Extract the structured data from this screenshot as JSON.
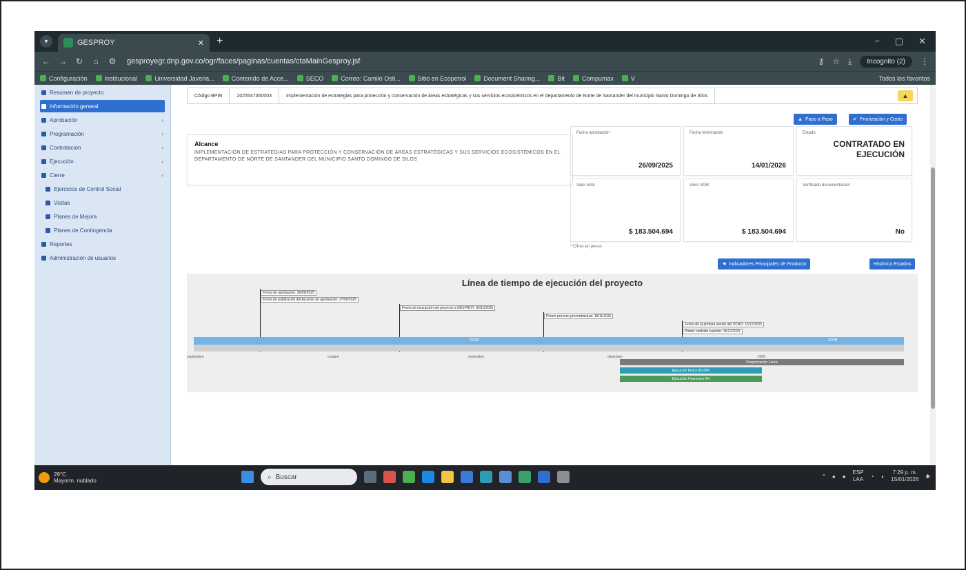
{
  "browser": {
    "tab_title": "GESPROY",
    "new_tab": "+",
    "window_controls": [
      "−",
      "▢",
      "✕"
    ],
    "url": "gesproyegr.dnp.gov.co/ogr/faces/paginas/cuentas/ctaMainGesproy.jsf",
    "incognito_label": "Incognito (2)",
    "bookmarks": [
      "Configuración",
      "Institucional",
      "Universidad Javeria...",
      "Contenido de Acce...",
      "SECO",
      "Correo: Camilo Osti...",
      "Sitio en Ecopetrol",
      "Document Sharing...",
      "Bit",
      "Compumax",
      "V"
    ],
    "bookmarks_right": "Todos los favoritos"
  },
  "sidebar": {
    "items": [
      {
        "label": "Resumen de proyecto",
        "active": false,
        "chevron": false
      },
      {
        "label": "Información general",
        "active": true,
        "chevron": false
      },
      {
        "label": "Aprobación",
        "active": false,
        "chevron": true
      },
      {
        "label": "Programación",
        "active": false,
        "chevron": true
      },
      {
        "label": "Contratación",
        "active": false,
        "chevron": true
      },
      {
        "label": "Ejecución",
        "active": false,
        "chevron": true
      },
      {
        "label": "Cierre",
        "active": false,
        "chevron": true
      },
      {
        "label": "Ejercicios de Control Social",
        "active": false,
        "chevron": false
      },
      {
        "label": "Visitas",
        "active": false,
        "chevron": false
      },
      {
        "label": "Planes de Mejora",
        "active": false,
        "chevron": false
      },
      {
        "label": "Planes de Contingencia",
        "active": false,
        "chevron": false
      },
      {
        "label": "Reportes",
        "active": false,
        "chevron": false
      },
      {
        "label": "Administración de usuarios",
        "active": false,
        "chevron": false
      }
    ]
  },
  "project": {
    "code_label": "Código BPIN",
    "code_value": "2025547450003",
    "title": "Implementación de estrategias para protección y conservación de áreas estratégicas y sus servicios ecosistémicos en el departamento de Norte de Santander del municipio Santo Domingo de Silos",
    "btn_paso": "Paso a Paso",
    "btn_priorizacion": "Priorización y Costo",
    "alcance_heading": "Alcance",
    "alcance_text": "IMPLEMENTACIÓN DE ESTRATEGIAS PARA PROTECCIÓN Y CONSERVACIÓN DE ÁREAS ESTRATÉGICAS Y SUS SERVICIOS ECOSISTÉMICOS EN EL DEPARTAMENTO DE NORTE DE SANTANDER DEL MUNICIPIO SANTO DOMINGO DE SILOS",
    "fecha_aprobacion_label": "Fecha aprobación",
    "fecha_aprobacion": "26/09/2025",
    "fecha_terminacion_label": "Fecha terminación",
    "fecha_terminacion": "14/01/2026",
    "estado_label": "Estado",
    "estado": "CONTRATADO EN EJECUCIÓN",
    "valor_total_label": "Valor total",
    "valor_total": "$ 183.504.694",
    "valor_sgr_label": "Valor SGR",
    "valor_sgr": "$ 183.504.694",
    "verificado_label": "Verificado documentación",
    "verificado": "No",
    "note": "* Cifras en pesos",
    "btn_indicadores": "Indicadores Principales de Producto",
    "btn_historico": "Histórico Estados"
  },
  "timeline": {
    "title": "Línea de tiempo de ejecución del proyecto",
    "events": [
      "Fecha de aprobación: 26/09/2025",
      "Fecha de publicación del Acuerdo de aprobación: 27/09/2025",
      "Fecha de inscripción del proyecto a GESPROY: 06/10/2025",
      "Primer proceso precontractual: 18/11/2025",
      "Fecha de la primera sesión del OCAD: 15/12/2025",
      "Primer contrato suscrito: 15/12/2025"
    ],
    "year_a": "2025",
    "year_b": "2026",
    "months": [
      "septiembre",
      "octubre",
      "noviembre",
      "diciembre",
      "2026"
    ],
    "phases": [
      {
        "label": "Programación Fisica",
        "color": "#7a7a7a"
      },
      {
        "label": "Ejecución Física 95,09%",
        "color": "#2f9bb5"
      },
      {
        "label": "Ejecución Financiera 0%",
        "color": "#4c9a55"
      }
    ]
  },
  "taskbar": {
    "temp": "29°C",
    "weather": "Mayorm. nublado",
    "search": "Buscar",
    "lang": "ESP",
    "lang2": "LAA",
    "time": "7:29 p. m.",
    "date": "15/01/2026"
  }
}
